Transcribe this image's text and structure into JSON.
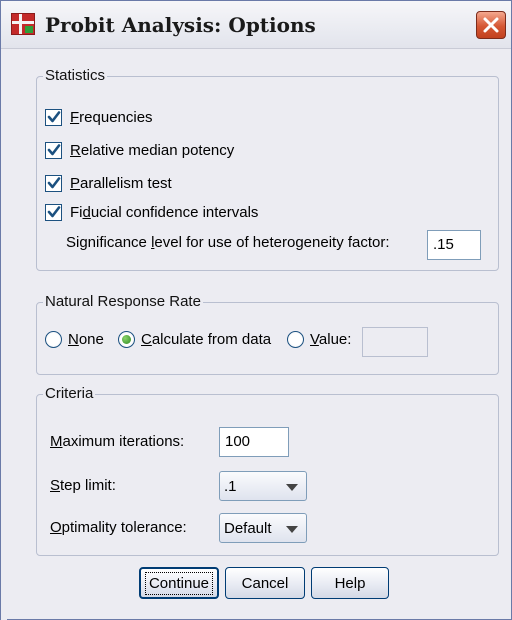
{
  "window": {
    "title": "Probit Analysis: Options"
  },
  "statistics": {
    "legend": "Statistics",
    "items": [
      {
        "label_key": "F",
        "label_rest": "requencies",
        "checked": true
      },
      {
        "label_key": "R",
        "label_rest": "elative median potency",
        "checked": true
      },
      {
        "label_key": "P",
        "label_rest": "arallelism test",
        "checked": true
      },
      {
        "label_pre": "Fi",
        "label_key": "d",
        "label_rest": "ucial confidence intervals",
        "checked": true
      }
    ],
    "significance_label_pre": "Significance ",
    "significance_label_key": "l",
    "significance_label_rest": "evel for use of heterogeneity factor:",
    "significance_value": ".15"
  },
  "natural_response": {
    "legend": "Natural Response Rate",
    "options": [
      {
        "key": "N",
        "rest": "one",
        "checked": false
      },
      {
        "key": "C",
        "rest": "alculate from data",
        "checked": true
      },
      {
        "key": "V",
        "rest": "alue:",
        "checked": false
      }
    ],
    "value": ""
  },
  "criteria": {
    "legend": "Criteria",
    "max_iter_key": "M",
    "max_iter_rest": "aximum iterations:",
    "max_iter_value": "100",
    "step_key": "S",
    "step_rest": "tep limit:",
    "step_value": ".1",
    "opt_key": "O",
    "opt_rest": "ptimality tolerance:",
    "opt_value": "Default"
  },
  "buttons": {
    "continue": "Continue",
    "cancel": "Cancel",
    "help": "Help"
  },
  "colors": {
    "accent": "#1c5180",
    "close": "#d55734"
  }
}
